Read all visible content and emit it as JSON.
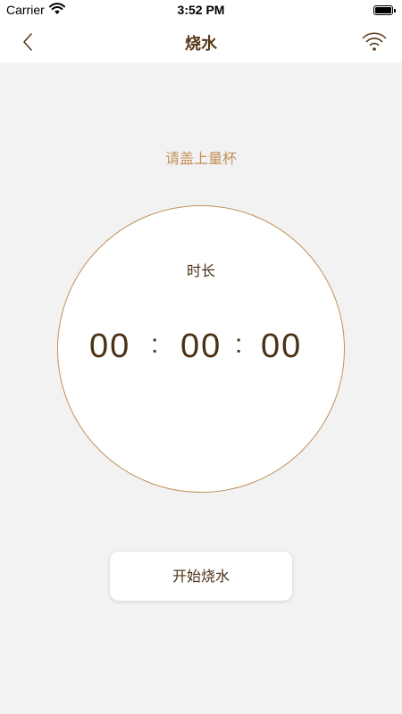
{
  "status_bar": {
    "carrier": "Carrier",
    "time": "3:52 PM"
  },
  "nav": {
    "title": "烧水",
    "back_icon": "chevron-left-icon",
    "right_icon": "wifi-icon"
  },
  "hint": "请盖上量杯",
  "timer": {
    "label": "时长",
    "hours": "00",
    "minutes": "00",
    "seconds": "00",
    "separator": ":"
  },
  "start_button": {
    "label": "开始烧水"
  },
  "colors": {
    "accent": "#c4925a",
    "text_brown": "#4a3116",
    "background": "#f2f2f2"
  }
}
